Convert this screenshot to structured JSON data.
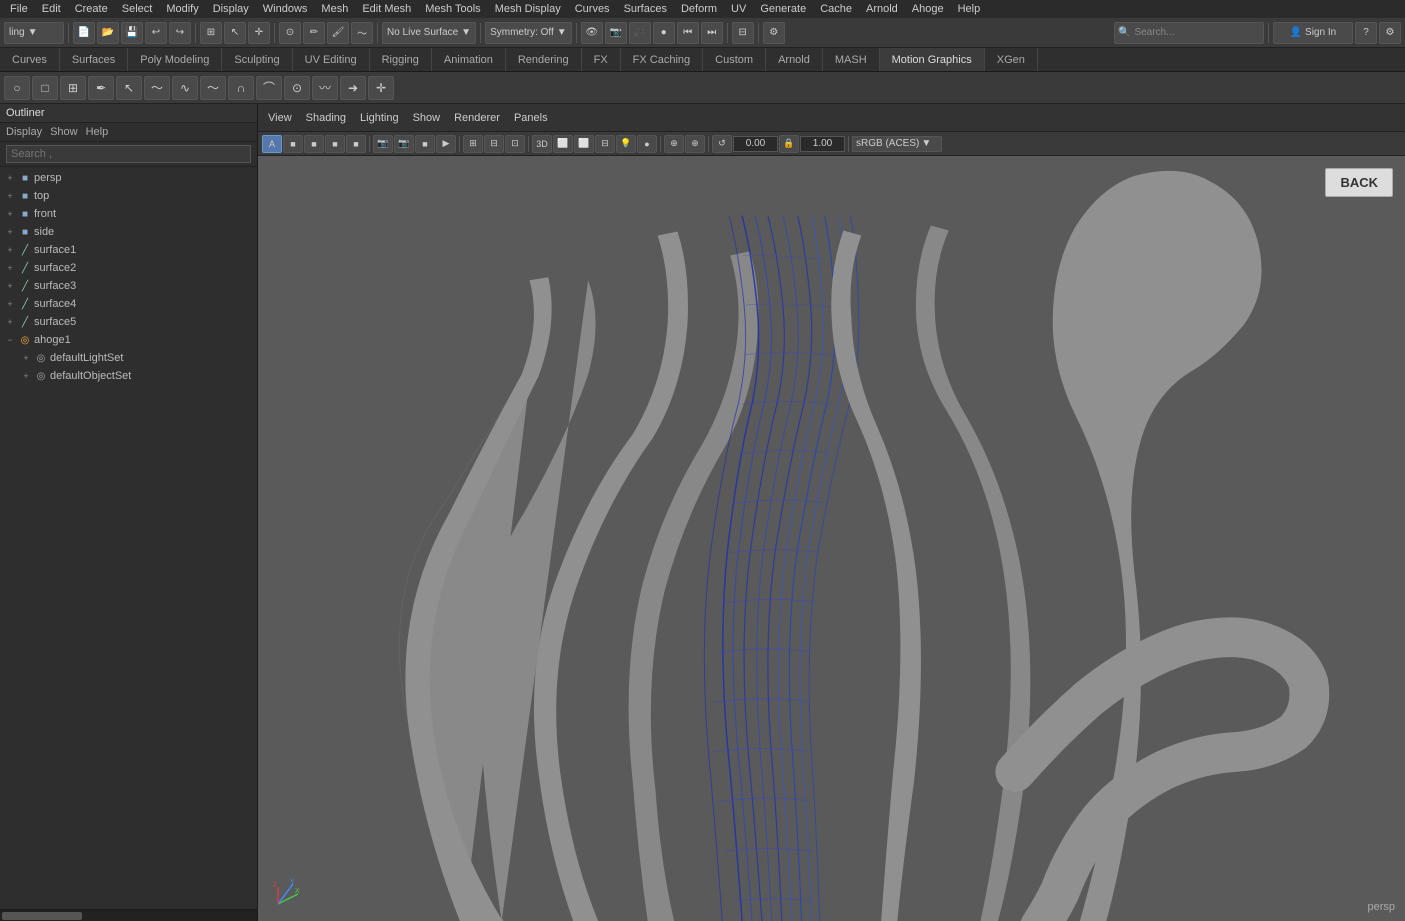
{
  "menubar": {
    "items": [
      "File",
      "Edit",
      "Create",
      "Select",
      "Modify",
      "Display",
      "Windows",
      "Mesh",
      "Edit Mesh",
      "Mesh Tools",
      "Mesh Display",
      "Curves",
      "Surfaces",
      "Deform",
      "UV",
      "Generate",
      "Cache",
      "Arnold",
      "Ahoge",
      "Help"
    ]
  },
  "toolbar1": {
    "layout_dropdown": "ling",
    "live_surface": "No Live Surface",
    "symmetry": "Symmetry: Off"
  },
  "tabs": {
    "items": [
      "Curves",
      "Surfaces",
      "Poly Modeling",
      "Sculpting",
      "UV Editing",
      "Rigging",
      "Animation",
      "Rendering",
      "FX",
      "FX Caching",
      "Custom",
      "Arnold",
      "MASH",
      "Motion Graphics",
      "XGen"
    ]
  },
  "outliner": {
    "title": "Outliner",
    "sub_menu": [
      "Display",
      "Show",
      "Help"
    ],
    "search_placeholder": "Search ,",
    "items": [
      {
        "id": "persp",
        "label": "persp",
        "type": "cam",
        "level": 0,
        "expanded": false
      },
      {
        "id": "top",
        "label": "top",
        "type": "cam",
        "level": 0,
        "expanded": false
      },
      {
        "id": "front",
        "label": "front",
        "type": "cam",
        "level": 0,
        "expanded": false
      },
      {
        "id": "side",
        "label": "side",
        "type": "cam",
        "level": 0,
        "expanded": false
      },
      {
        "id": "surface1",
        "label": "surface1",
        "type": "surf",
        "level": 0,
        "expanded": false
      },
      {
        "id": "surface2",
        "label": "surface2",
        "type": "surf",
        "level": 0,
        "expanded": false
      },
      {
        "id": "surface3",
        "label": "surface3",
        "type": "surf",
        "level": 0,
        "expanded": false
      },
      {
        "id": "surface4",
        "label": "surface4",
        "type": "surf",
        "level": 0,
        "expanded": false
      },
      {
        "id": "surface5",
        "label": "surface5",
        "type": "surf",
        "level": 0,
        "expanded": false
      },
      {
        "id": "ahoge1",
        "label": "ahoge1",
        "type": "node",
        "level": 0,
        "expanded": true
      },
      {
        "id": "defaultLightSet",
        "label": "defaultLightSet",
        "type": "set",
        "level": 1,
        "expanded": false
      },
      {
        "id": "defaultObjectSet",
        "label": "defaultObjectSet",
        "type": "set",
        "level": 1,
        "expanded": false
      }
    ]
  },
  "viewport": {
    "menus": [
      "View",
      "Shading",
      "Lighting",
      "Show",
      "Renderer",
      "Panels"
    ],
    "color_profile": "sRGB (ACES)",
    "value1": "0.00",
    "value2": "1.00",
    "back_button": "BACK",
    "persp_label": "persp"
  }
}
